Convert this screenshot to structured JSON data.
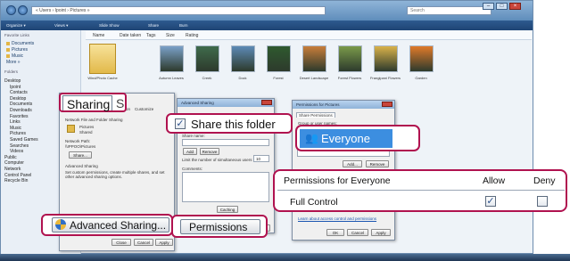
{
  "explorer": {
    "address": "« Users › Ipoint › Pictures »",
    "search_placeholder": "Search",
    "toolbar": [
      "Organize ▾",
      "Views ▾",
      "Slide Show",
      "Share",
      "Burn"
    ],
    "columns": [
      "Name",
      "Date taken",
      "Tags",
      "Size",
      "Rating"
    ],
    "favorites_header": "Favorite Links",
    "favorites": [
      "Documents",
      "Pictures",
      "Music",
      "More »"
    ],
    "folders_header": "Folders",
    "tree": [
      "Desktop",
      "Ipoint",
      "Contacts",
      "Desktop",
      "Documents",
      "Downloads",
      "Favorites",
      "Links",
      "Music",
      "Pictures",
      "Saved Games",
      "Searches",
      "Videos",
      "Public",
      "Computer",
      "Network",
      "Control Panel",
      "Recycle Bin"
    ],
    "thumbnails": [
      "Wind/Photo Cache",
      "Autumn Leaves",
      "Creek",
      "Dock",
      "Forest",
      "Desert Landscape",
      "Forest Flowers",
      "Frangipani Flowers",
      "Garden"
    ]
  },
  "properties_dialog": {
    "tabs": [
      "General",
      "Sharing",
      "Security",
      "Location",
      "Customize"
    ],
    "network_heading": "Network File and Folder Sharing",
    "folder_name": "Pictures",
    "folder_state": "Shared",
    "network_path_label": "Network Path:",
    "network_path": "\\\\IPPOO\\Pictures",
    "share_button": "Share...",
    "advanced_heading": "Advanced Sharing",
    "advanced_desc": "Set custom permissions, create multiple shares, and set other advanced sharing options.",
    "close_button": "Close",
    "cancel_button": "Cancel",
    "apply_button": "Apply"
  },
  "advanced_dialog": {
    "title": "Advanced Sharing",
    "settings_label": "Settings",
    "share_name_label": "Share name:",
    "add_button": "Add",
    "remove_button": "Remove",
    "limit_label": "Limit the number of simultaneous users to:",
    "limit_value": "10",
    "comments_label": "Comments:",
    "caching_button": "Caching",
    "ok_button": "OK",
    "cancel_button": "Cancel",
    "apply_button": "Apply"
  },
  "permissions_dialog": {
    "title": "Permissions for Pictures",
    "share_permissions_tab": "Share Permissions",
    "group_label": "Group or user names:",
    "add_button": "Add...",
    "remove_button": "Remove",
    "learn_link": "Learn about access control and permissions",
    "ok_button": "OK",
    "cancel_button": "Cancel",
    "apply_button": "Apply"
  },
  "callouts": {
    "sharing_tab": "Sharing",
    "sharing_tab_partial": "S",
    "share_this_folder": "Share this folder",
    "everyone": "Everyone",
    "permissions_header": "Permissions for Everyone",
    "allow_header": "Allow",
    "deny_header": "Deny",
    "full_control": "Full Control",
    "advanced_sharing_button": "Advanced Sharing...",
    "permissions_button": "Permissions"
  },
  "colors": {
    "callout_border": "#b0124f",
    "selection_blue": "#3c8ee0"
  }
}
